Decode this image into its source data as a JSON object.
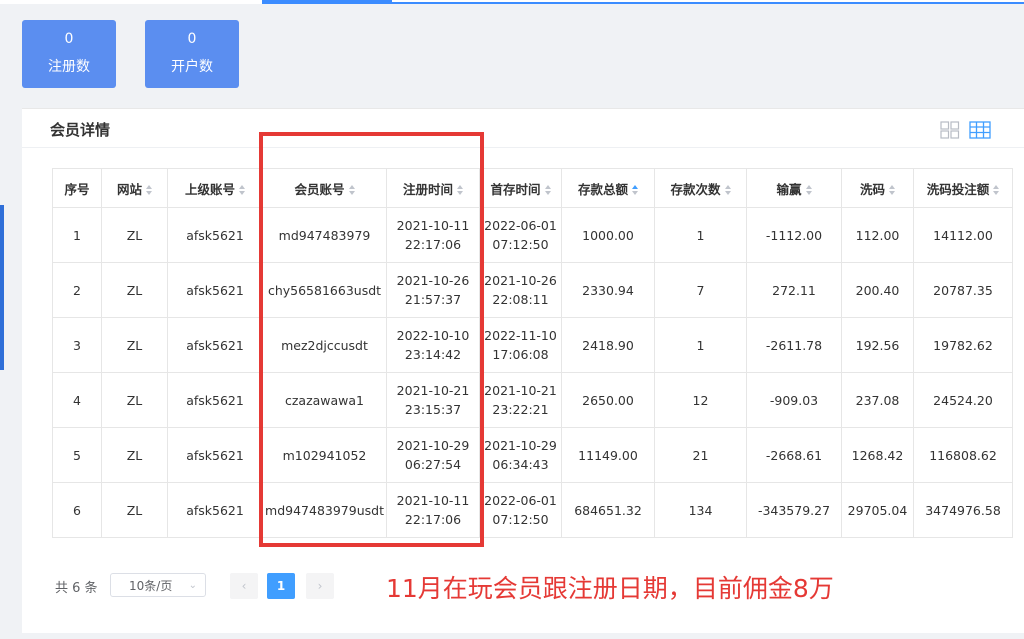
{
  "stats": [
    {
      "value": "0",
      "label": "注册数"
    },
    {
      "value": "0",
      "label": "开户数"
    }
  ],
  "panel": {
    "title": "会员详情"
  },
  "view_icons": [
    "grid-view-icon",
    "table-view-icon"
  ],
  "table": {
    "headers": [
      "序号",
      "网站",
      "上级账号",
      "会员账号",
      "注册时间",
      "首存时间",
      "存款总额",
      "存款次数",
      "输赢",
      "洗码",
      "洗码投注额"
    ],
    "sort_state": {
      "存款总额": "ascending"
    },
    "rows": [
      {
        "idx": "1",
        "site": "ZL",
        "parent": "afsk5621",
        "account": "md947483979",
        "reg_date": "2021-10-11",
        "reg_time": "22:17:06",
        "first_date": "2022-06-01",
        "first_time": "07:12:50",
        "dep_total": "1000.00",
        "dep_count": "1",
        "winloss": "-1112.00",
        "rebate": "112.00",
        "rebate_bet": "14112.00"
      },
      {
        "idx": "2",
        "site": "ZL",
        "parent": "afsk5621",
        "account": "chy56581663usdt",
        "reg_date": "2021-10-26",
        "reg_time": "21:57:37",
        "first_date": "2021-10-26",
        "first_time": "22:08:11",
        "dep_total": "2330.94",
        "dep_count": "7",
        "winloss": "272.11",
        "rebate": "200.40",
        "rebate_bet": "20787.35"
      },
      {
        "idx": "3",
        "site": "ZL",
        "parent": "afsk5621",
        "account": "mez2djccusdt",
        "reg_date": "2022-10-10",
        "reg_time": "23:14:42",
        "first_date": "2022-11-10",
        "first_time": "17:06:08",
        "dep_total": "2418.90",
        "dep_count": "1",
        "winloss": "-2611.78",
        "rebate": "192.56",
        "rebate_bet": "19782.62"
      },
      {
        "idx": "4",
        "site": "ZL",
        "parent": "afsk5621",
        "account": "czazawawa1",
        "reg_date": "2021-10-21",
        "reg_time": "23:15:37",
        "first_date": "2021-10-21",
        "first_time": "23:22:21",
        "dep_total": "2650.00",
        "dep_count": "12",
        "winloss": "-909.03",
        "rebate": "237.08",
        "rebate_bet": "24524.20"
      },
      {
        "idx": "5",
        "site": "ZL",
        "parent": "afsk5621",
        "account": "m102941052",
        "reg_date": "2021-10-29",
        "reg_time": "06:27:54",
        "first_date": "2021-10-29",
        "first_time": "06:34:43",
        "dep_total": "11149.00",
        "dep_count": "21",
        "winloss": "-2668.61",
        "rebate": "1268.42",
        "rebate_bet": "116808.62"
      },
      {
        "idx": "6",
        "site": "ZL",
        "parent": "afsk5621",
        "account": "md947483979usdt",
        "reg_date": "2021-10-11",
        "reg_time": "22:17:06",
        "first_date": "2022-06-01",
        "first_time": "07:12:50",
        "dep_total": "684651.32",
        "dep_count": "134",
        "winloss": "-343579.27",
        "rebate": "29705.04",
        "rebate_bet": "3474976.58"
      }
    ]
  },
  "pagination": {
    "total": "共 6 条",
    "page_size": "10条/页",
    "prev": "‹",
    "current_page": "1",
    "next": "›"
  },
  "annotation": "11月在玩会员跟注册日期，目前佣金8万",
  "colors": {
    "stat_card": "#5b8ef0",
    "active_page": "#409eff",
    "highlight": "#e53935"
  }
}
